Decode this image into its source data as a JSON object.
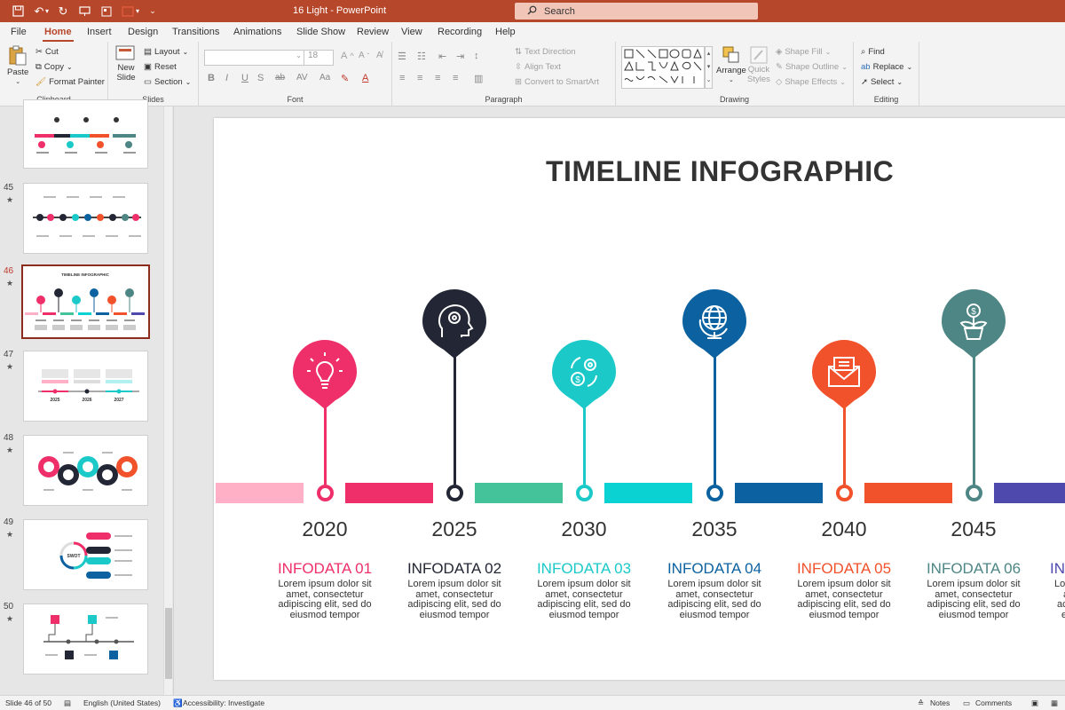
{
  "app": {
    "doc_title": "16 Light  -  PowerPoint",
    "search_placeholder": "Search"
  },
  "tabs": [
    "File",
    "Home",
    "Insert",
    "Design",
    "Transitions",
    "Animations",
    "Slide Show",
    "Review",
    "View",
    "Recording",
    "Help"
  ],
  "active_tab": "Home",
  "ribbon": {
    "clipboard": {
      "paste": "Paste",
      "cut": "Cut",
      "copy": "Copy",
      "format_painter": "Format Painter",
      "label": "Clipboard"
    },
    "slides": {
      "new_slide": "New",
      "new_slide2": "Slide",
      "layout": "Layout",
      "reset": "Reset",
      "section": "Section",
      "label": "Slides"
    },
    "font": {
      "size": "18",
      "label": "Font"
    },
    "paragraph": {
      "text_direction": "Text Direction",
      "align_text": "Align Text",
      "convert": "Convert to SmartArt",
      "label": "Paragraph"
    },
    "drawing": {
      "arrange": "Arrange",
      "quick_styles": "Quick",
      "quick_styles2": "Styles",
      "shape_fill": "Shape Fill",
      "shape_outline": "Shape Outline",
      "shape_effects": "Shape Effects",
      "label": "Drawing"
    },
    "editing": {
      "find": "Find",
      "replace": "Replace",
      "select": "Select",
      "label": "Editing"
    }
  },
  "thumbnails": {
    "numbers": [
      "45",
      "46",
      "47",
      "48",
      "49",
      "50"
    ],
    "active": "46",
    "thumb_title": "TIMELINE INFOGRAPHIC",
    "t47_years": [
      "2025",
      "2026",
      "2027"
    ],
    "t49_label": "SWOT"
  },
  "slide": {
    "title": "TIMELINE INFOGRAPHIC",
    "colors": [
      "#ee2f6a",
      "#232634",
      "#1cc9c9",
      "#0c62a0",
      "#f1512b",
      "#4d8684"
    ],
    "bar_colors": [
      "#ffb0c6",
      "#ee2f6a",
      "#44c39a",
      "#0ad2d2",
      "#0c62a0",
      "#f1512b",
      "#4d49ad"
    ],
    "icons": [
      "lightbulb-icon",
      "head-gear-icon",
      "gear-dollar-icon",
      "globe-icon",
      "envelope-icon",
      "plant-dollar-icon"
    ],
    "items": [
      {
        "year": "2020",
        "title": "INFODATA 01",
        "body": "Lorem ipsum dolor sit amet, consectetur adipiscing elit, sed do eiusmod tempor"
      },
      {
        "year": "2025",
        "title": "INFODATA 02",
        "body": "Lorem ipsum dolor sit amet, consectetur adipiscing elit, sed do eiusmod tempor"
      },
      {
        "year": "2030",
        "title": "INFODATA 03",
        "body": "Lorem ipsum dolor sit amet, consectetur adipiscing elit, sed do eiusmod tempor"
      },
      {
        "year": "2035",
        "title": "INFODATA 04",
        "body": "Lorem ipsum dolor sit amet, consectetur adipiscing elit, sed do eiusmod tempor"
      },
      {
        "year": "2040",
        "title": "INFODATA 05",
        "body": "Lorem ipsum dolor sit amet, consectetur adipiscing elit, sed do eiusmod tempor"
      },
      {
        "year": "2045",
        "title": "INFODATA 06",
        "body": "Lorem ipsum dolor sit amet, consectetur adipiscing elit, sed do eiusmod tempor"
      }
    ],
    "cutoff_title": "IN",
    "cutoff_body": [
      "Lo",
      "a",
      "ac",
      "e"
    ]
  },
  "status": {
    "slide_info": "Slide 46 of 50",
    "language": "English (United States)",
    "accessibility": "Accessibility: Investigate",
    "notes": "Notes",
    "comments": "Comments"
  }
}
